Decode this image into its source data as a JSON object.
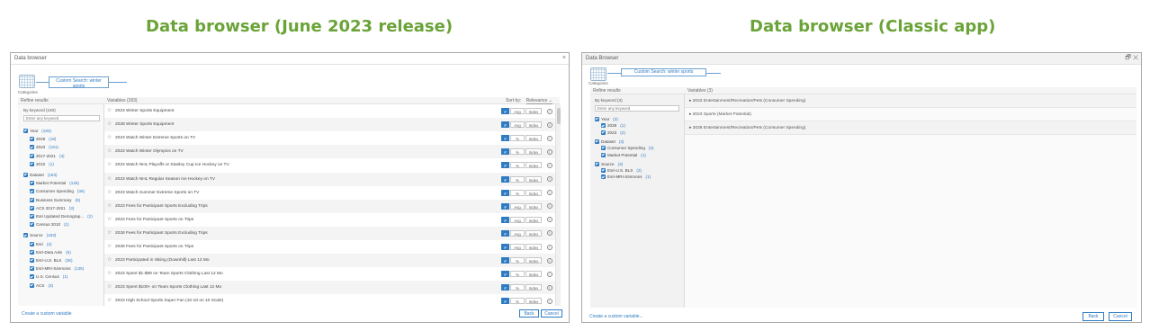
{
  "headings": {
    "left": "Data browser (June 2023 release)",
    "right": "Data browser (Classic app)"
  },
  "new_app": {
    "title": "Data browser",
    "close_glyph": "×",
    "categories_label": "Categories",
    "chip_label": "Custom Search: winter sports",
    "refine_header": "Refine results",
    "variables_header": "Variables (183)",
    "sort_by_label": "Sort by:",
    "sort_value": "Relevance",
    "by_keyword": "By keyword (183)",
    "keyword_placeholder": "Enter any keyword",
    "facets": [
      {
        "label": "Year",
        "count": "(183)",
        "level": 0
      },
      {
        "label": "2028",
        "count": "(18)",
        "level": 1
      },
      {
        "label": "2023",
        "count": "(161)",
        "level": 1
      },
      {
        "label": "2017-2021",
        "count": "(3)",
        "level": 1
      },
      {
        "label": "2010",
        "count": "(1)",
        "level": 1
      },
      {
        "label": "Dataset",
        "count": "(183)",
        "level": 0
      },
      {
        "label": "Market Potential",
        "count": "(135)",
        "level": 1
      },
      {
        "label": "Consumer Spending",
        "count": "(36)",
        "level": 1
      },
      {
        "label": "Business Summary",
        "count": "(6)",
        "level": 1
      },
      {
        "label": "ACS 2017-2021",
        "count": "(3)",
        "level": 1
      },
      {
        "label": "Esri Updated Demograp...",
        "count": "(2)",
        "level": 1
      },
      {
        "label": "Census 2010",
        "count": "(1)",
        "level": 1
      },
      {
        "label": "Source",
        "count": "(183)",
        "level": 0
      },
      {
        "label": "Esri",
        "count": "(2)",
        "level": 1
      },
      {
        "label": "Esri-Data Axle",
        "count": "(6)",
        "level": 1
      },
      {
        "label": "Esri-U.S. BLS",
        "count": "(36)",
        "level": 1
      },
      {
        "label": "Esri-MRI-Simmons",
        "count": "(135)",
        "level": 1
      },
      {
        "label": "U.S. Census",
        "count": "(1)",
        "level": 1
      },
      {
        "label": "ACS",
        "count": "(3)",
        "level": 1
      }
    ],
    "variables": [
      {
        "name": "2023 Winter Sports Equipment",
        "first": "#",
        "second": "Avg",
        "third": "Index"
      },
      {
        "name": "2028 Winter Sports Equipment",
        "first": "#",
        "second": "Avg",
        "third": "Index"
      },
      {
        "name": "2023 Watch Winter Extreme Sports on TV",
        "first": "#",
        "second": "%",
        "third": "Index"
      },
      {
        "name": "2023 Watch Winter Olympics on TV",
        "first": "#",
        "second": "%",
        "third": "Index"
      },
      {
        "name": "2023 Watch NHL Playoffs or Stanley Cup Ice Hockey on TV",
        "first": "#",
        "second": "%",
        "third": "Index"
      },
      {
        "name": "2023 Watch NHL Regular Season Ice Hockey on TV",
        "first": "#",
        "second": "%",
        "third": "Index"
      },
      {
        "name": "2023 Watch Summer Extreme Sports on TV",
        "first": "#",
        "second": "%",
        "third": "Index"
      },
      {
        "name": "2023 Fees for Participant Sports Excluding Trips",
        "first": "#",
        "second": "Avg",
        "third": "Index"
      },
      {
        "name": "2023 Fees for Participant Sports on Trips",
        "first": "#",
        "second": "Avg",
        "third": "Index"
      },
      {
        "name": "2028 Fees for Participant Sports Excluding Trips",
        "first": "#",
        "second": "Avg",
        "third": "Index"
      },
      {
        "name": "2028 Fees for Participant Sports on Trips",
        "first": "#",
        "second": "Avg",
        "third": "Index"
      },
      {
        "name": "2023 Participated in Skiing (Downhill) Last 12 Mo",
        "first": "#",
        "second": "%",
        "third": "Index"
      },
      {
        "name": "2023 Spent $1-$99 on Team Sports Clothing Last 12 Mo",
        "first": "#",
        "second": "%",
        "third": "Index"
      },
      {
        "name": "2023 Spent $100+ on Team Sports Clothing Last 12 Mo",
        "first": "#",
        "second": "%",
        "third": "Index"
      },
      {
        "name": "2023 High School Sports Super Fan (10-10 on 10 Scale)",
        "first": "#",
        "second": "%",
        "third": "Index"
      }
    ],
    "create_link": "Create a custom variable",
    "back_label": "Back",
    "cancel_label": "Cancel"
  },
  "classic_app": {
    "title": "Data Browser",
    "window_glyphs": "🗗 ✕",
    "categories_label": "Categories",
    "chip_label": "Custom Search: winter sports",
    "refine_header": "Refine results",
    "variables_header": "Variables (3)",
    "by_keyword": "By keyword (3)",
    "keyword_placeholder": "Enter any keyword",
    "facets": [
      {
        "label": "Year",
        "count": "(3)",
        "level": 0
      },
      {
        "label": "2028",
        "count": "(1)",
        "level": 1
      },
      {
        "label": "2023",
        "count": "(2)",
        "level": 1
      },
      {
        "label": "Dataset",
        "count": "(3)",
        "level": 0
      },
      {
        "label": "Consumer Spending",
        "count": "(2)",
        "level": 1
      },
      {
        "label": "Market Potential",
        "count": "(1)",
        "level": 1
      },
      {
        "label": "Source",
        "count": "(3)",
        "level": 0
      },
      {
        "label": "Esri-U.S. BLS",
        "count": "(2)",
        "level": 1
      },
      {
        "label": "Esri-MRI-Simmons",
        "count": "(1)",
        "level": 1
      }
    ],
    "variables": [
      "▸ 2023 Entertainment/Recreation/Pets (Consumer Spending)",
      "▸ 2023 Sports (Market Potential)",
      "▸ 2028 Entertainment/Recreation/Pets (Consumer Spending)"
    ],
    "create_link": "Create a custom variable...",
    "back_label": "Back",
    "cancel_label": "Cancel"
  },
  "colors": {
    "heading": "#6aa337",
    "accent": "#2f7bc2"
  }
}
